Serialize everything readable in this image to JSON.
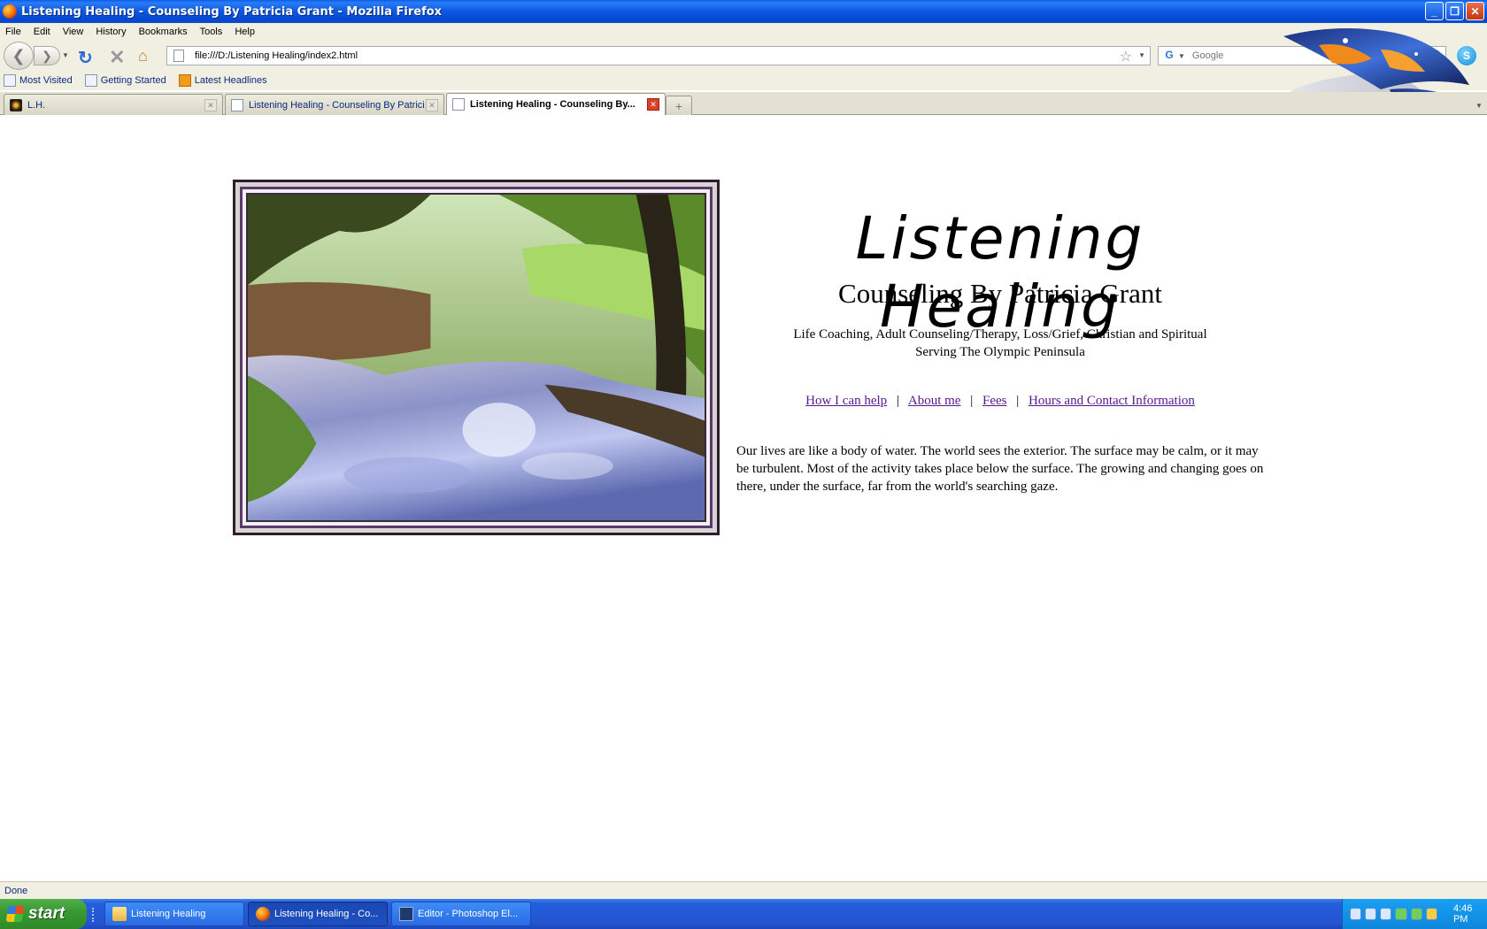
{
  "window": {
    "title": "Listening Healing - Counseling By Patricia Grant - Mozilla Firefox",
    "minimize": "_",
    "maximize": "❐",
    "close": "✕"
  },
  "menu": [
    "File",
    "Edit",
    "View",
    "History",
    "Bookmarks",
    "Tools",
    "Help"
  ],
  "nav": {
    "url": "file:///D:/Listening Healing/index2.html",
    "search_placeholder": "Google"
  },
  "bookmarks": [
    "Most Visited",
    "Getting Started",
    "Latest Headlines"
  ],
  "tabs": [
    {
      "label": "L.H."
    },
    {
      "label": "Listening Healing - Counseling By Patrici..."
    },
    {
      "label": "Listening Healing - Counseling By..."
    }
  ],
  "page": {
    "title": "Listening Healing",
    "subtitle": "Counseling By Patricia Grant",
    "tagline_1": "Life Coaching, Adult Counseling/Therapy, Loss/Grief, Christian and Spiritual",
    "tagline_2": "Serving The Olympic Peninsula",
    "links": [
      "How I can help",
      "About me",
      "Fees",
      "Hours and Contact Information"
    ],
    "separator": "|",
    "intro": "Our lives are like a body of water. The world sees the exterior. The surface may be calm, or it may be turbulent. Most of the activity takes place below the surface. The growing and changing goes on there, under the surface, far from the world's searching gaze."
  },
  "status": "Done",
  "taskbar": {
    "start": "start",
    "tasks": [
      "Listening Healing",
      "Listening Healing - Co...",
      "Editor - Photoshop El..."
    ],
    "clock": "4:46 PM"
  }
}
